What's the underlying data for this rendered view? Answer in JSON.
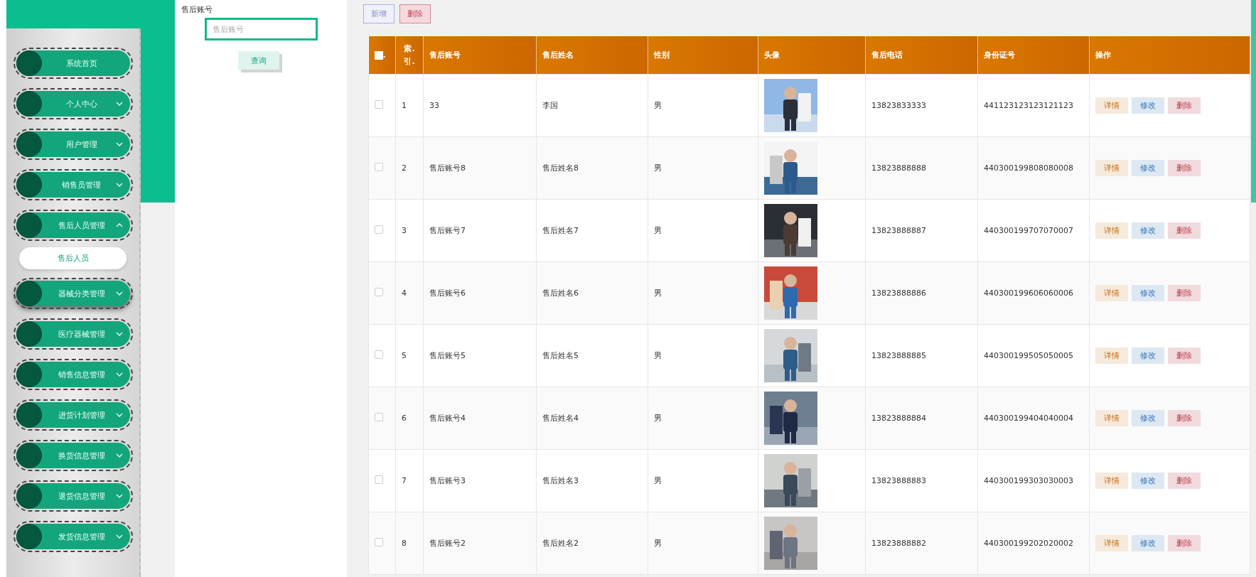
{
  "sidebar": {
    "items": [
      {
        "label": "系统首页",
        "kind": "link",
        "hovered": false
      },
      {
        "label": "个人中心",
        "kind": "menu",
        "expanded": false,
        "hovered": false
      },
      {
        "label": "用户管理",
        "kind": "menu",
        "expanded": false,
        "hovered": false
      },
      {
        "label": "销售员管理",
        "kind": "menu",
        "expanded": false,
        "hovered": false
      },
      {
        "label": "售后人员管理",
        "kind": "menu",
        "expanded": true,
        "hovered": false,
        "children": [
          {
            "label": "售后人员"
          }
        ]
      },
      {
        "label": "器械分类管理",
        "kind": "menu",
        "expanded": false,
        "hovered": true
      },
      {
        "label": "医疗器械管理",
        "kind": "menu",
        "expanded": false,
        "hovered": false
      },
      {
        "label": "销售信息管理",
        "kind": "menu",
        "expanded": false,
        "hovered": false
      },
      {
        "label": "进货计划管理",
        "kind": "menu",
        "expanded": false,
        "hovered": false
      },
      {
        "label": "换货信息管理",
        "kind": "menu",
        "expanded": false,
        "hovered": false
      },
      {
        "label": "退货信息管理",
        "kind": "menu",
        "expanded": false,
        "hovered": false
      },
      {
        "label": "发货信息管理",
        "kind": "menu",
        "expanded": false,
        "hovered": false
      }
    ]
  },
  "search": {
    "label": "售后账号",
    "placeholder": "售后账号",
    "button": "查询"
  },
  "toolbar": {
    "add": "新增",
    "delete": "删除"
  },
  "table": {
    "columns": [
      {
        "label": ".",
        "kind": "checkbox",
        "checked": false
      },
      {
        "label": "索.引.",
        "kind": "index"
      },
      {
        "label": "售后账号",
        "kind": "text"
      },
      {
        "label": "售后姓名",
        "kind": "text"
      },
      {
        "label": "性别",
        "kind": "text"
      },
      {
        "label": "头像"
      },
      {
        "label": "售后电话",
        "kind": "text"
      },
      {
        "label": "身份证号",
        "kind": "text"
      },
      {
        "label": "操作",
        "kind": "actions"
      }
    ],
    "rows": [
      {
        "checked": false,
        "index": "1",
        "account": "33",
        "name": "李国",
        "gender": "男",
        "phone": "13823833333",
        "id_number": "441123123123121123",
        "actions": [
          "详情",
          "修改",
          "删除"
        ]
      },
      {
        "checked": false,
        "index": "2",
        "account": "售后账号8",
        "name": "售后姓名8",
        "gender": "男",
        "phone": "13823888888",
        "id_number": "440300199808080008",
        "actions": [
          "详情",
          "修改",
          "删除"
        ]
      },
      {
        "checked": false,
        "index": "3",
        "account": "售后账号7",
        "name": "售后姓名7",
        "gender": "男",
        "phone": "13823888887",
        "id_number": "440300199707070007",
        "actions": [
          "详情",
          "修改",
          "删除"
        ]
      },
      {
        "checked": false,
        "index": "4",
        "account": "售后账号6",
        "name": "售后姓名6",
        "gender": "男",
        "phone": "13823888886",
        "id_number": "440300199606060006",
        "actions": [
          "详情",
          "修改",
          "删除"
        ]
      },
      {
        "checked": false,
        "index": "5",
        "account": "售后账号5",
        "name": "售后姓名5",
        "gender": "男",
        "phone": "13823888885",
        "id_number": "440300199505050005",
        "actions": [
          "详情",
          "修改",
          "删除"
        ]
      },
      {
        "checked": false,
        "index": "6",
        "account": "售后账号4",
        "name": "售后姓名4",
        "gender": "男",
        "phone": "13823888884",
        "id_number": "440300199404040004",
        "actions": [
          "详情",
          "修改",
          "删除"
        ]
      },
      {
        "checked": false,
        "index": "7",
        "account": "售后账号3",
        "name": "售后姓名3",
        "gender": "男",
        "phone": "13823888883",
        "id_number": "440300199303030003",
        "actions": [
          "详情",
          "修改",
          "删除"
        ]
      },
      {
        "checked": false,
        "index": "8",
        "account": "售后账号2",
        "name": "售后姓名2",
        "gender": "男",
        "phone": "13823888882",
        "id_number": "440300199202020002",
        "actions": [
          "详情",
          "修改",
          "删除"
        ]
      }
    ]
  }
}
